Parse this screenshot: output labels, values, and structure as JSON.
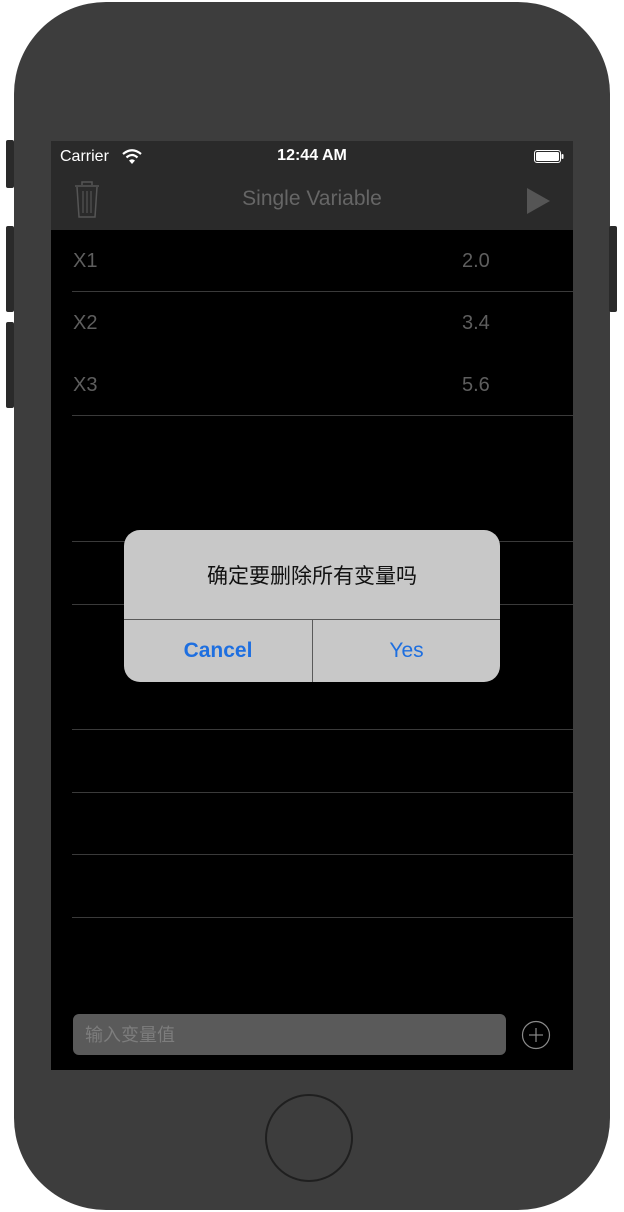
{
  "status_bar": {
    "carrier": "Carrier",
    "time": "12:44 AM"
  },
  "nav": {
    "title": "Single Variable"
  },
  "variables": [
    {
      "name": "X1",
      "value": "2.0"
    },
    {
      "name": "X2",
      "value": "3.4"
    },
    {
      "name": "X3",
      "value": "5.6"
    }
  ],
  "input": {
    "placeholder": "输入变量值",
    "value": ""
  },
  "alert": {
    "message": "确定要删除所有变量吗",
    "cancel_label": "Cancel",
    "yes_label": "Yes"
  },
  "colors": {
    "alert_button": "#1e6fe0",
    "nav_bar": "#2a2a2a",
    "list_text": "#5e5e5e"
  }
}
